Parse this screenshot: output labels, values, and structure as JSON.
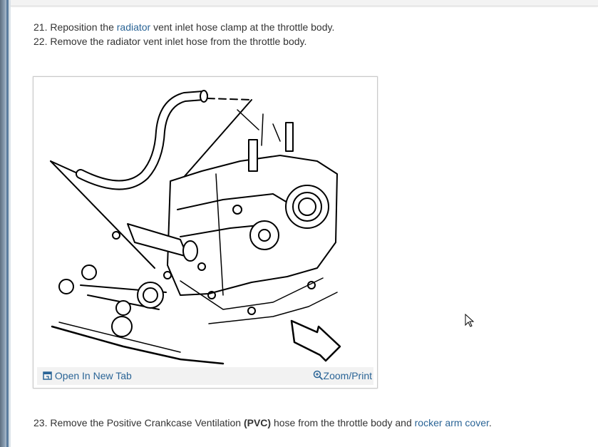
{
  "steps": {
    "s21": {
      "before": "21. Reposition the ",
      "link": "radiator",
      "after": " vent inlet hose clamp at the throttle body."
    },
    "s22": {
      "text": "22. Remove the radiator vent inlet hose from the throttle body."
    },
    "s23": {
      "before": "23. Remove the Positive Crankcase Ventilation ",
      "bold": "(PVC)",
      "middle": " hose from the throttle body and ",
      "link": "rocker arm cover",
      "after": "."
    }
  },
  "figure": {
    "open_label": "Open In New Tab",
    "zoom_label": "Zoom/Print",
    "icons": {
      "open": "open-new-tab-icon",
      "zoom": "zoom-icon"
    }
  },
  "colors": {
    "link": "#2a6496",
    "text": "#333333",
    "toolbar": "#f2f2f2"
  }
}
